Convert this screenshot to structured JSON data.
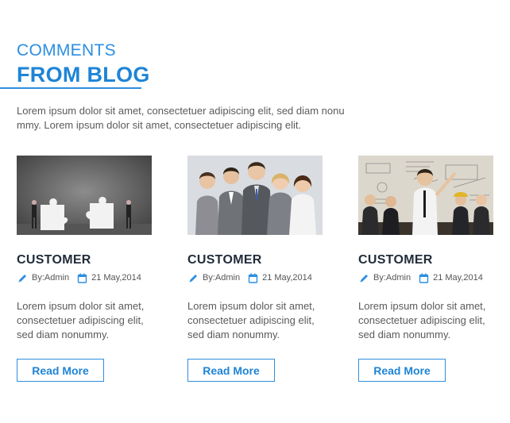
{
  "heading": {
    "top": "COMMENTS",
    "main": "FROM BLOG"
  },
  "intro": "Lorem ipsum dolor sit amet, consectetuer adipiscing elit, sed diam nonu mmy. Lorem ipsum dolor sit amet, consectetuer adipiscing elit.",
  "accent_color": "#2d8ee0",
  "cards": [
    {
      "image": "puzzle-pieces-photo",
      "title": "CUSTOMER",
      "author": "By:Admin",
      "date": "21 May,2014",
      "text": "Lorem ipsum dolor sit amet, consectetuer adipiscing elit, sed diam nonummy.",
      "button": "Read More"
    },
    {
      "image": "business-team-photo",
      "title": "CUSTOMER",
      "author": "By:Admin",
      "date": "21 May,2014",
      "text": "Lorem ipsum dolor sit amet, consectetuer adipiscing elit, sed diam nonummy.",
      "button": "Read More"
    },
    {
      "image": "business-meeting-photo",
      "title": "CUSTOMER",
      "author": "By:Admin",
      "date": "21 May,2014",
      "text": "Lorem ipsum dolor sit amet, consectetuer adipiscing elit, sed diam nonummy.",
      "button": "Read More"
    }
  ],
  "icons": {
    "author": "pencil-icon",
    "date": "calendar-icon"
  }
}
